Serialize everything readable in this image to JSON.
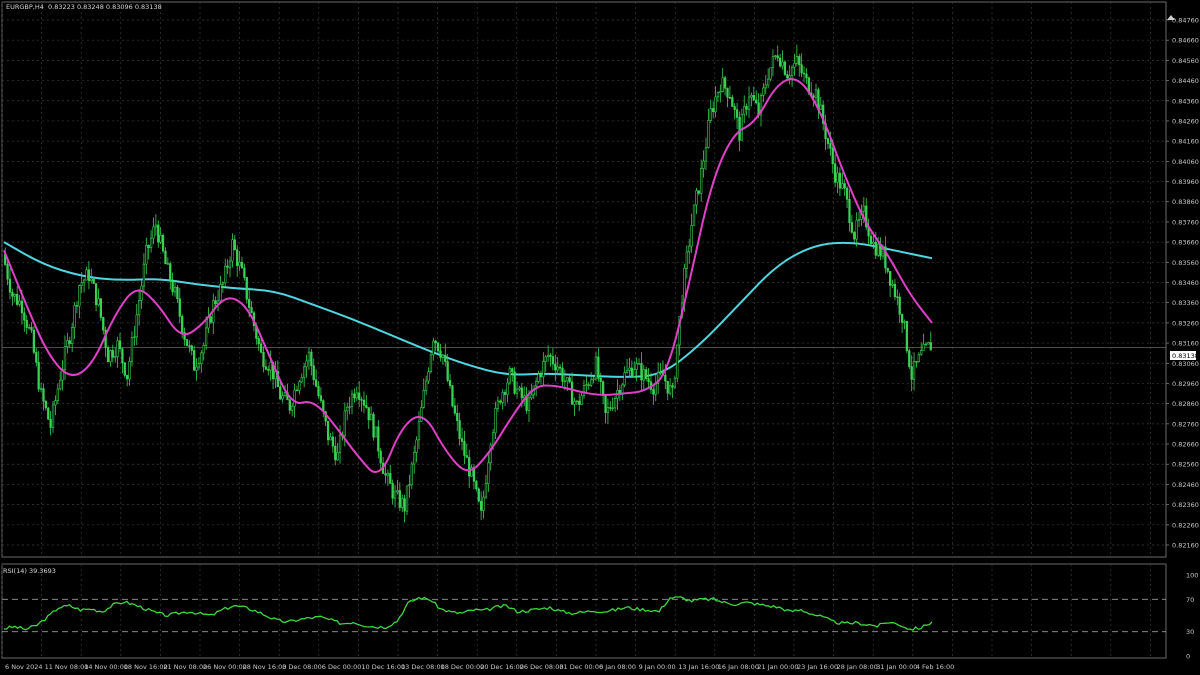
{
  "header": {
    "symbol": "EURGBP,H4",
    "ohlc": "0.83223 0.83248 0.83096 0.83138"
  },
  "rsi_header": "RSI(14) 39.3693",
  "price_badge": "0.83138",
  "colors": {
    "background": "#000000",
    "grid": "#3a3a3a",
    "bull_candle": "#39d353",
    "ma_fast": "#e040c8",
    "ma_slow": "#4fd6e0",
    "rsi_line": "#3cd83c",
    "text": "#c8c8c8"
  },
  "chart_data": [
    {
      "type": "candlestick",
      "symbol": "EURGBP",
      "timeframe": "H4",
      "ylim": [
        0.8216,
        0.8476
      ],
      "y_ticks": [
        "0.84760",
        "0.84660",
        "0.84560",
        "0.84460",
        "0.84360",
        "0.84260",
        "0.84160",
        "0.84060",
        "0.83960",
        "0.83860",
        "0.83760",
        "0.83660",
        "0.83560",
        "0.83460",
        "0.83360",
        "0.83260",
        "0.83160",
        "0.83060",
        "0.82960",
        "0.82860",
        "0.82760",
        "0.82660",
        "0.82560",
        "0.82460",
        "0.82360",
        "0.82260",
        "0.82160"
      ],
      "x_ticks": [
        "6 Nov 2024",
        "11 Nov 08:00",
        "14 Nov 00:00",
        "18 Nov 16:00",
        "21 Nov 08:00",
        "26 Nov 00:00",
        "28 Nov 16:00",
        "3 Dec 08:00",
        "6 Dec 00:00",
        "10 Dec 16:00",
        "13 Dec 08:00",
        "18 Dec 00:00",
        "20 Dec 16:00",
        "26 Dec 08:00",
        "31 Dec 00:00",
        "6 Jan 08:00",
        "9 Jan 00:00",
        "13 Jan 16:00",
        "16 Jan 08:00",
        "21 Jan 00:00",
        "23 Jan 16:00",
        "28 Jan 08:00",
        "31 Jan 00:00",
        "4 Feb 16:00"
      ],
      "series": [
        {
          "name": "",
          "style": "candles",
          "close": [
            0.836,
            0.834,
            0.8335,
            0.8318,
            0.829,
            0.8275,
            0.83,
            0.832,
            0.8345,
            0.835,
            0.8335,
            0.831,
            0.8315,
            0.83,
            0.833,
            0.836,
            0.8375,
            0.8355,
            0.834,
            0.832,
            0.8305,
            0.8315,
            0.8335,
            0.8345,
            0.8365,
            0.835,
            0.833,
            0.831,
            0.8305,
            0.829,
            0.8285,
            0.83,
            0.831,
            0.829,
            0.827,
            0.826,
            0.8285,
            0.8295,
            0.8285,
            0.827,
            0.825,
            0.824,
            0.8235,
            0.826,
            0.829,
            0.832,
            0.831,
            0.8285,
            0.8265,
            0.825,
            0.823,
            0.827,
            0.829,
            0.83,
            0.829,
            0.8285,
            0.83,
            0.831,
            0.8305,
            0.8295,
            0.8285,
            0.8295,
            0.8305,
            0.828,
            0.829,
            0.83,
            0.8305,
            0.83,
            0.8295,
            0.83,
            0.829,
            0.834,
            0.8375,
            0.84,
            0.843,
            0.8445,
            0.844,
            0.842,
            0.844,
            0.843,
            0.845,
            0.846,
            0.845,
            0.8455,
            0.8445,
            0.844,
            0.842,
            0.84,
            0.839,
            0.837,
            0.838,
            0.8365,
            0.836,
            0.8345,
            0.833,
            0.83,
            0.831,
            0.8315
          ]
        },
        {
          "name": "",
          "style": "line",
          "values": [
            0.8362,
            0.8335,
            0.831,
            0.8298,
            0.8305,
            0.833,
            0.8345,
            0.8335,
            0.8318,
            0.8325,
            0.834,
            0.8335,
            0.831,
            0.8285,
            0.8288,
            0.8275,
            0.826,
            0.8248,
            0.8275,
            0.8282,
            0.8262,
            0.825,
            0.8262,
            0.828,
            0.8295,
            0.8295,
            0.8292,
            0.829,
            0.8291,
            0.8292,
            0.83,
            0.8345,
            0.8395,
            0.842,
            0.8425,
            0.8445,
            0.8448,
            0.843,
            0.84,
            0.8375,
            0.836,
            0.834,
            0.8326
          ]
        },
        {
          "name": "",
          "style": "line",
          "values": [
            0.8366,
            0.8355,
            0.8349,
            0.8347,
            0.8348,
            0.8345,
            0.8343,
            0.8342,
            0.8335,
            0.8328,
            0.832,
            0.8312,
            0.8305,
            0.83,
            0.8301,
            0.83,
            0.8299,
            0.83,
            0.8315,
            0.8335,
            0.8355,
            0.8365,
            0.8366,
            0.8362,
            0.8358
          ]
        }
      ]
    },
    {
      "type": "line",
      "indicator": "RSI(14)",
      "ylim": [
        0,
        100
      ],
      "y_ticks": [
        "100",
        "70",
        "30",
        "0"
      ],
      "levels": [
        70,
        30
      ],
      "series": [
        {
          "name": "",
          "values": [
            34,
            36,
            33,
            38,
            48,
            60,
            62,
            57,
            58,
            55,
            63,
            67,
            63,
            58,
            53,
            50,
            53,
            55,
            52,
            50,
            57,
            62,
            60,
            56,
            50,
            44,
            42,
            45,
            47,
            48,
            44,
            40,
            42,
            38,
            36,
            36,
            43,
            65,
            72,
            70,
            58,
            54,
            53,
            57,
            56,
            60,
            62,
            55,
            56,
            58,
            60,
            55,
            53,
            54,
            56,
            55,
            57,
            60,
            58,
            57,
            55,
            72,
            72,
            68,
            70,
            70,
            66,
            64,
            66,
            64,
            62,
            60,
            55,
            57,
            52,
            48,
            42,
            40,
            41,
            39,
            37,
            42,
            39,
            33,
            35,
            42
          ]
        }
      ]
    }
  ]
}
